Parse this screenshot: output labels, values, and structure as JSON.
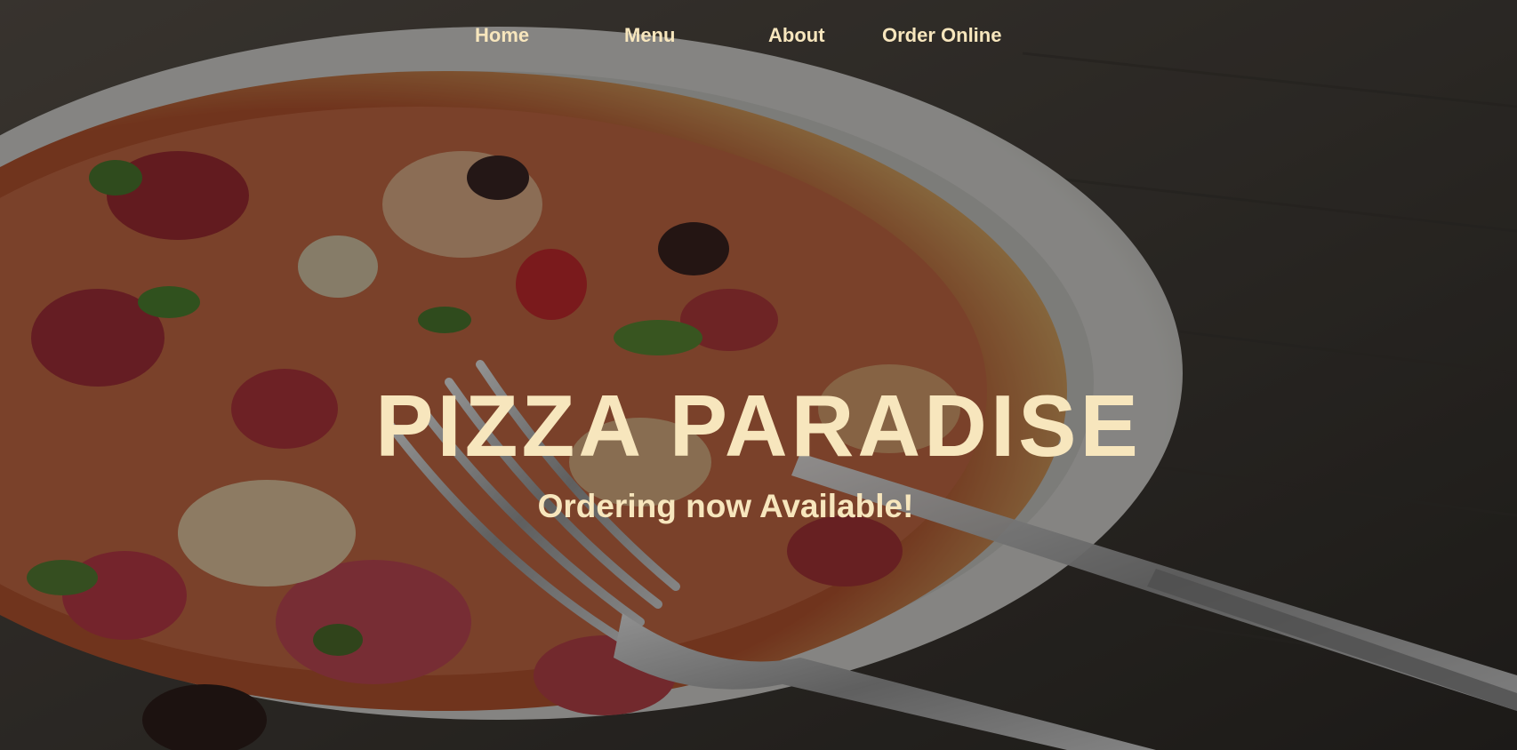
{
  "nav": {
    "links": [
      {
        "label": "Home"
      },
      {
        "label": "Menu"
      },
      {
        "label": "About"
      },
      {
        "label": "Order Online"
      }
    ]
  },
  "hero": {
    "title": "PIZZA PARADISE",
    "subtitle": "Ordering now Available!",
    "background_image": "pizza-with-fork-and-knife-photo"
  },
  "colors": {
    "text_cream": "#f7e6bd",
    "overlay": "rgba(0,0,0,0.38)"
  }
}
